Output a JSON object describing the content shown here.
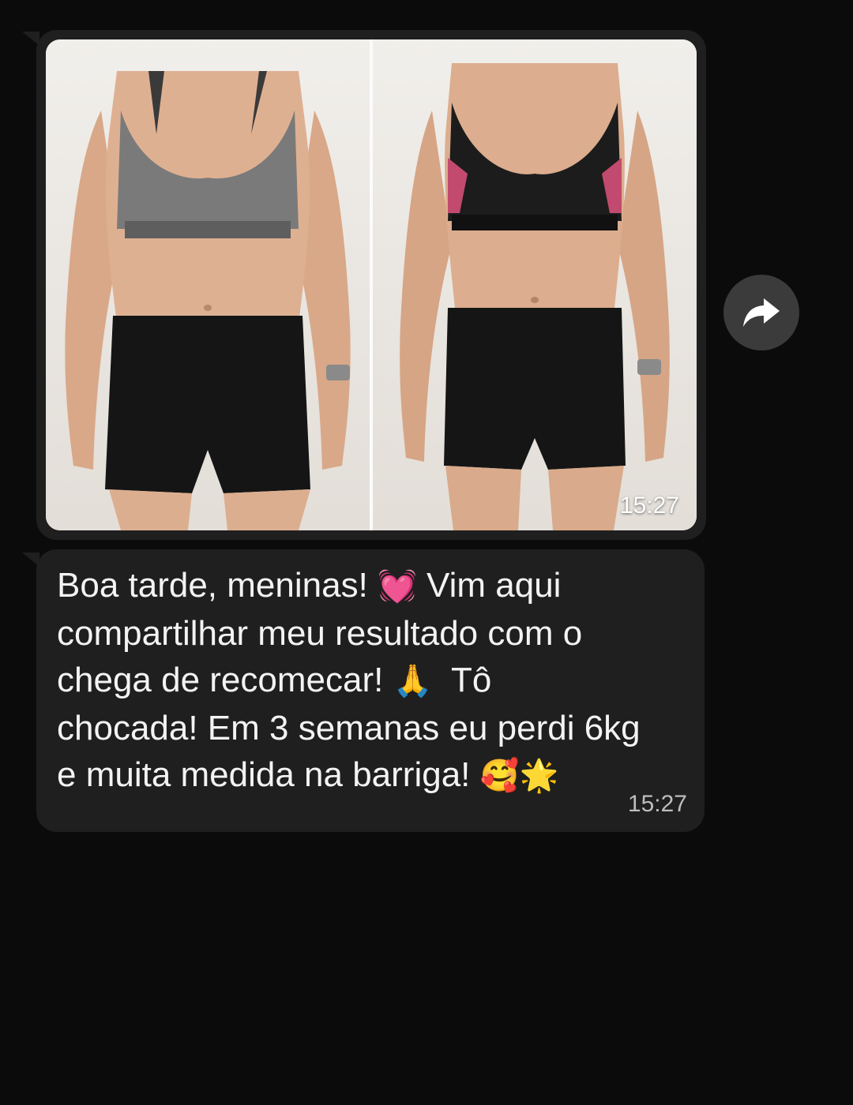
{
  "image_message": {
    "time": "15:27",
    "photo_left": "before-photo",
    "photo_right": "after-photo"
  },
  "forward_icon": "forward-arrow-icon",
  "text_message": {
    "line1": "Boa tarde, meninas! ",
    "emoji_heart": "💓",
    "line1b": " Vim aqui",
    "line2": "compartilhar meu resultado com o",
    "line3": "chega de recomecar! ",
    "emoji_pray": "🙏",
    "line3b": "  Tô",
    "line4": "chocada! Em 3 semanas eu perdi 6kg",
    "line5": "e muita medida na barriga! ",
    "emoji_smile": "🥰",
    "emoji_star": "🌟",
    "time": "15:27"
  },
  "colors": {
    "background": "#0b0b0b",
    "bubble": "#1f1f1f",
    "text": "#f3f3f3",
    "forward_button": "#3b3b3b"
  }
}
